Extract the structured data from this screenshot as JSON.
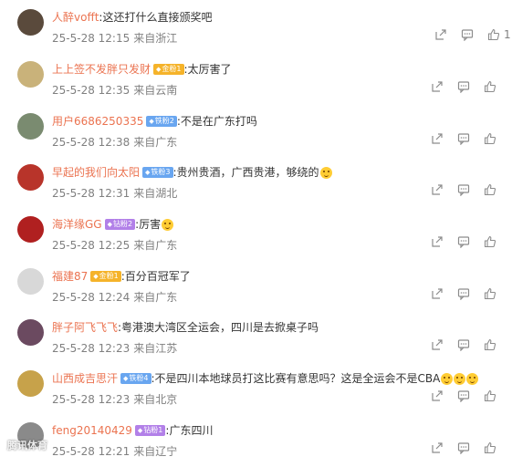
{
  "comments": [
    {
      "user": "人醉vofft",
      "badge": "",
      "badge_color": "",
      "text": ":这还打什么直接颁奖吧",
      "emoji_count": 0,
      "date": "25-5-28 12:15",
      "source": "来自浙江",
      "likes": "1",
      "avatar_bg": "#5a4a3c",
      "avatar_icon": "coin-avatar"
    },
    {
      "user": "上上签不发胖只发财",
      "badge": "金粉1",
      "badge_color": "gold",
      "text": ":太厉害了",
      "emoji_count": 0,
      "date": "25-5-28 12:35",
      "source": "来自云南",
      "likes": "",
      "avatar_bg": "#c9b27a",
      "avatar_icon": "landscape-avatar"
    },
    {
      "user": "用户6686250335",
      "badge": "铁粉2",
      "badge_color": "blue",
      "text": ":不是在广东打吗",
      "emoji_count": 0,
      "date": "25-5-28 12:38",
      "source": "来自广东",
      "likes": "",
      "avatar_bg": "#7a8b70",
      "avatar_icon": "photo-avatar"
    },
    {
      "user": "早起的我们向太阳",
      "badge": "铁粉3",
      "badge_color": "blue",
      "text": ":贵州贵酒，广西贵港，够绕的",
      "emoji_count": 1,
      "date": "25-5-28 12:31",
      "source": "来自湖北",
      "likes": "",
      "avatar_bg": "#b8342a",
      "avatar_icon": "star-avatar"
    },
    {
      "user": "海洋缘GG",
      "badge": "钻粉2",
      "badge_color": "purple",
      "text": ":厉害",
      "emoji_count": 1,
      "date": "25-5-28 12:25",
      "source": "来自广东",
      "likes": "",
      "avatar_bg": "#b02020",
      "avatar_icon": "pattern-avatar"
    },
    {
      "user": "福建87",
      "badge": "金粉1",
      "badge_color": "gold",
      "text": ":百分百冠军了",
      "emoji_count": 0,
      "date": "25-5-28 12:24",
      "source": "来自广东",
      "likes": "",
      "avatar_bg": "#d8d8d8",
      "avatar_icon": "default-avatar"
    },
    {
      "user": "胖子阿飞飞飞",
      "badge": "",
      "badge_color": "",
      "text": ":粤港澳大湾区全运会，四川是去掀桌子吗",
      "emoji_count": 0,
      "date": "25-5-28 12:23",
      "source": "来自江苏",
      "likes": "",
      "avatar_bg": "#6b4a60",
      "avatar_icon": "night-avatar"
    },
    {
      "user": "山西成吉思汗",
      "badge": "铁粉4",
      "badge_color": "blue",
      "text": ":不是四川本地球员打这比赛有意思吗？这是全运会不是CBA",
      "emoji_count": 3,
      "date": "25-5-28 12:23",
      "source": "来自北京",
      "likes": "",
      "avatar_bg": "#c7a24a",
      "avatar_icon": "gold-avatar"
    },
    {
      "user": "feng20140429",
      "badge": "钻粉1",
      "badge_color": "purple",
      "text": ":广东四川",
      "emoji_count": 0,
      "date": "25-5-28 12:21",
      "source": "来自辽宁",
      "likes": "",
      "avatar_bg": "#8a8a8a",
      "avatar_icon": "portrait-avatar"
    }
  ],
  "watermark": "腾讯体育"
}
